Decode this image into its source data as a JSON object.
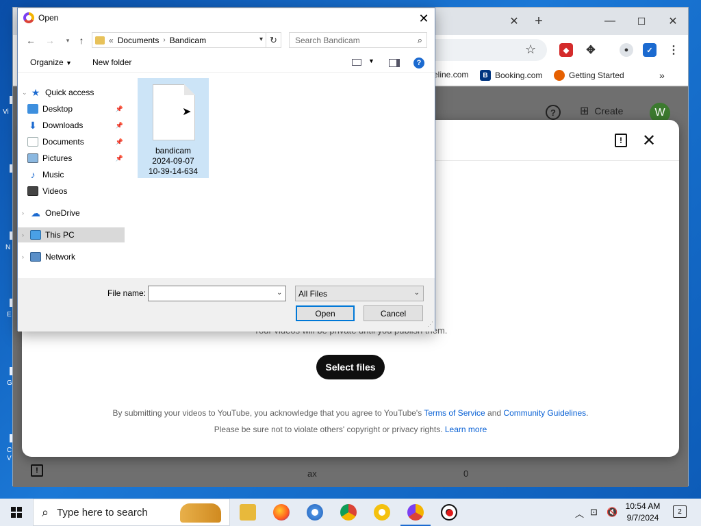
{
  "desktop_icon_fragments": [
    "Vi",
    "N",
    "E",
    "G",
    "C",
    "V"
  ],
  "chrome": {
    "bookmarks": [
      "eline.com",
      "Booking.com",
      "Getting Started"
    ]
  },
  "youtube": {
    "create_label": "Create",
    "avatar_letter": "W",
    "bottom_text": "ax",
    "bottom_value": "0"
  },
  "upload_dialog": {
    "private_note": "Your videos will be private until you publish them.",
    "select_files": "Select files",
    "terms_prefix": "By submitting your videos to YouTube, you acknowledge that you agree to YouTube's",
    "terms_link": "Terms of Service",
    "terms_and": "and",
    "guidelines_link": "Community Guidelines",
    "terms_end": ".",
    "privacy_text": "Please be sure not to violate others' copyright or privacy rights.",
    "learn_more": "Learn more"
  },
  "open_dialog": {
    "title": "Open",
    "breadcrumb_prefix": "«",
    "breadcrumb": [
      "Documents",
      "Bandicam"
    ],
    "search_placeholder": "Search Bandicam",
    "organize": "Organize",
    "new_folder": "New folder",
    "nav_items": [
      {
        "label": "Quick access",
        "icon": "star-icon"
      },
      {
        "label": "Desktop",
        "icon": "desktop-folder-icon",
        "pinned": true
      },
      {
        "label": "Downloads",
        "icon": "download-arrow-icon",
        "pinned": true
      },
      {
        "label": "Documents",
        "icon": "document-icon",
        "pinned": true
      },
      {
        "label": "Pictures",
        "icon": "picture-icon",
        "pinned": true
      },
      {
        "label": "Music",
        "icon": "music-note-icon"
      },
      {
        "label": "Videos",
        "icon": "film-icon"
      },
      {
        "label": "OneDrive",
        "icon": "cloud-icon"
      },
      {
        "label": "This PC",
        "icon": "computer-icon",
        "selected": true
      },
      {
        "label": "Network",
        "icon": "network-icon"
      }
    ],
    "file": {
      "name_line1": "bandicam",
      "name_line2": "2024-09-07",
      "name_line3": "10-39-14-634"
    },
    "file_name_label": "File name:",
    "file_name_value": "",
    "filter": "All Files",
    "open_button": "Open",
    "cancel_button": "Cancel"
  },
  "taskbar": {
    "search_placeholder": "Type here to search",
    "time": "10:54 AM",
    "date": "9/7/2024",
    "notification_count": "2"
  },
  "colors": {
    "link": "#065fd4",
    "selection": "#cce4f7",
    "accent": "#0078d7"
  }
}
